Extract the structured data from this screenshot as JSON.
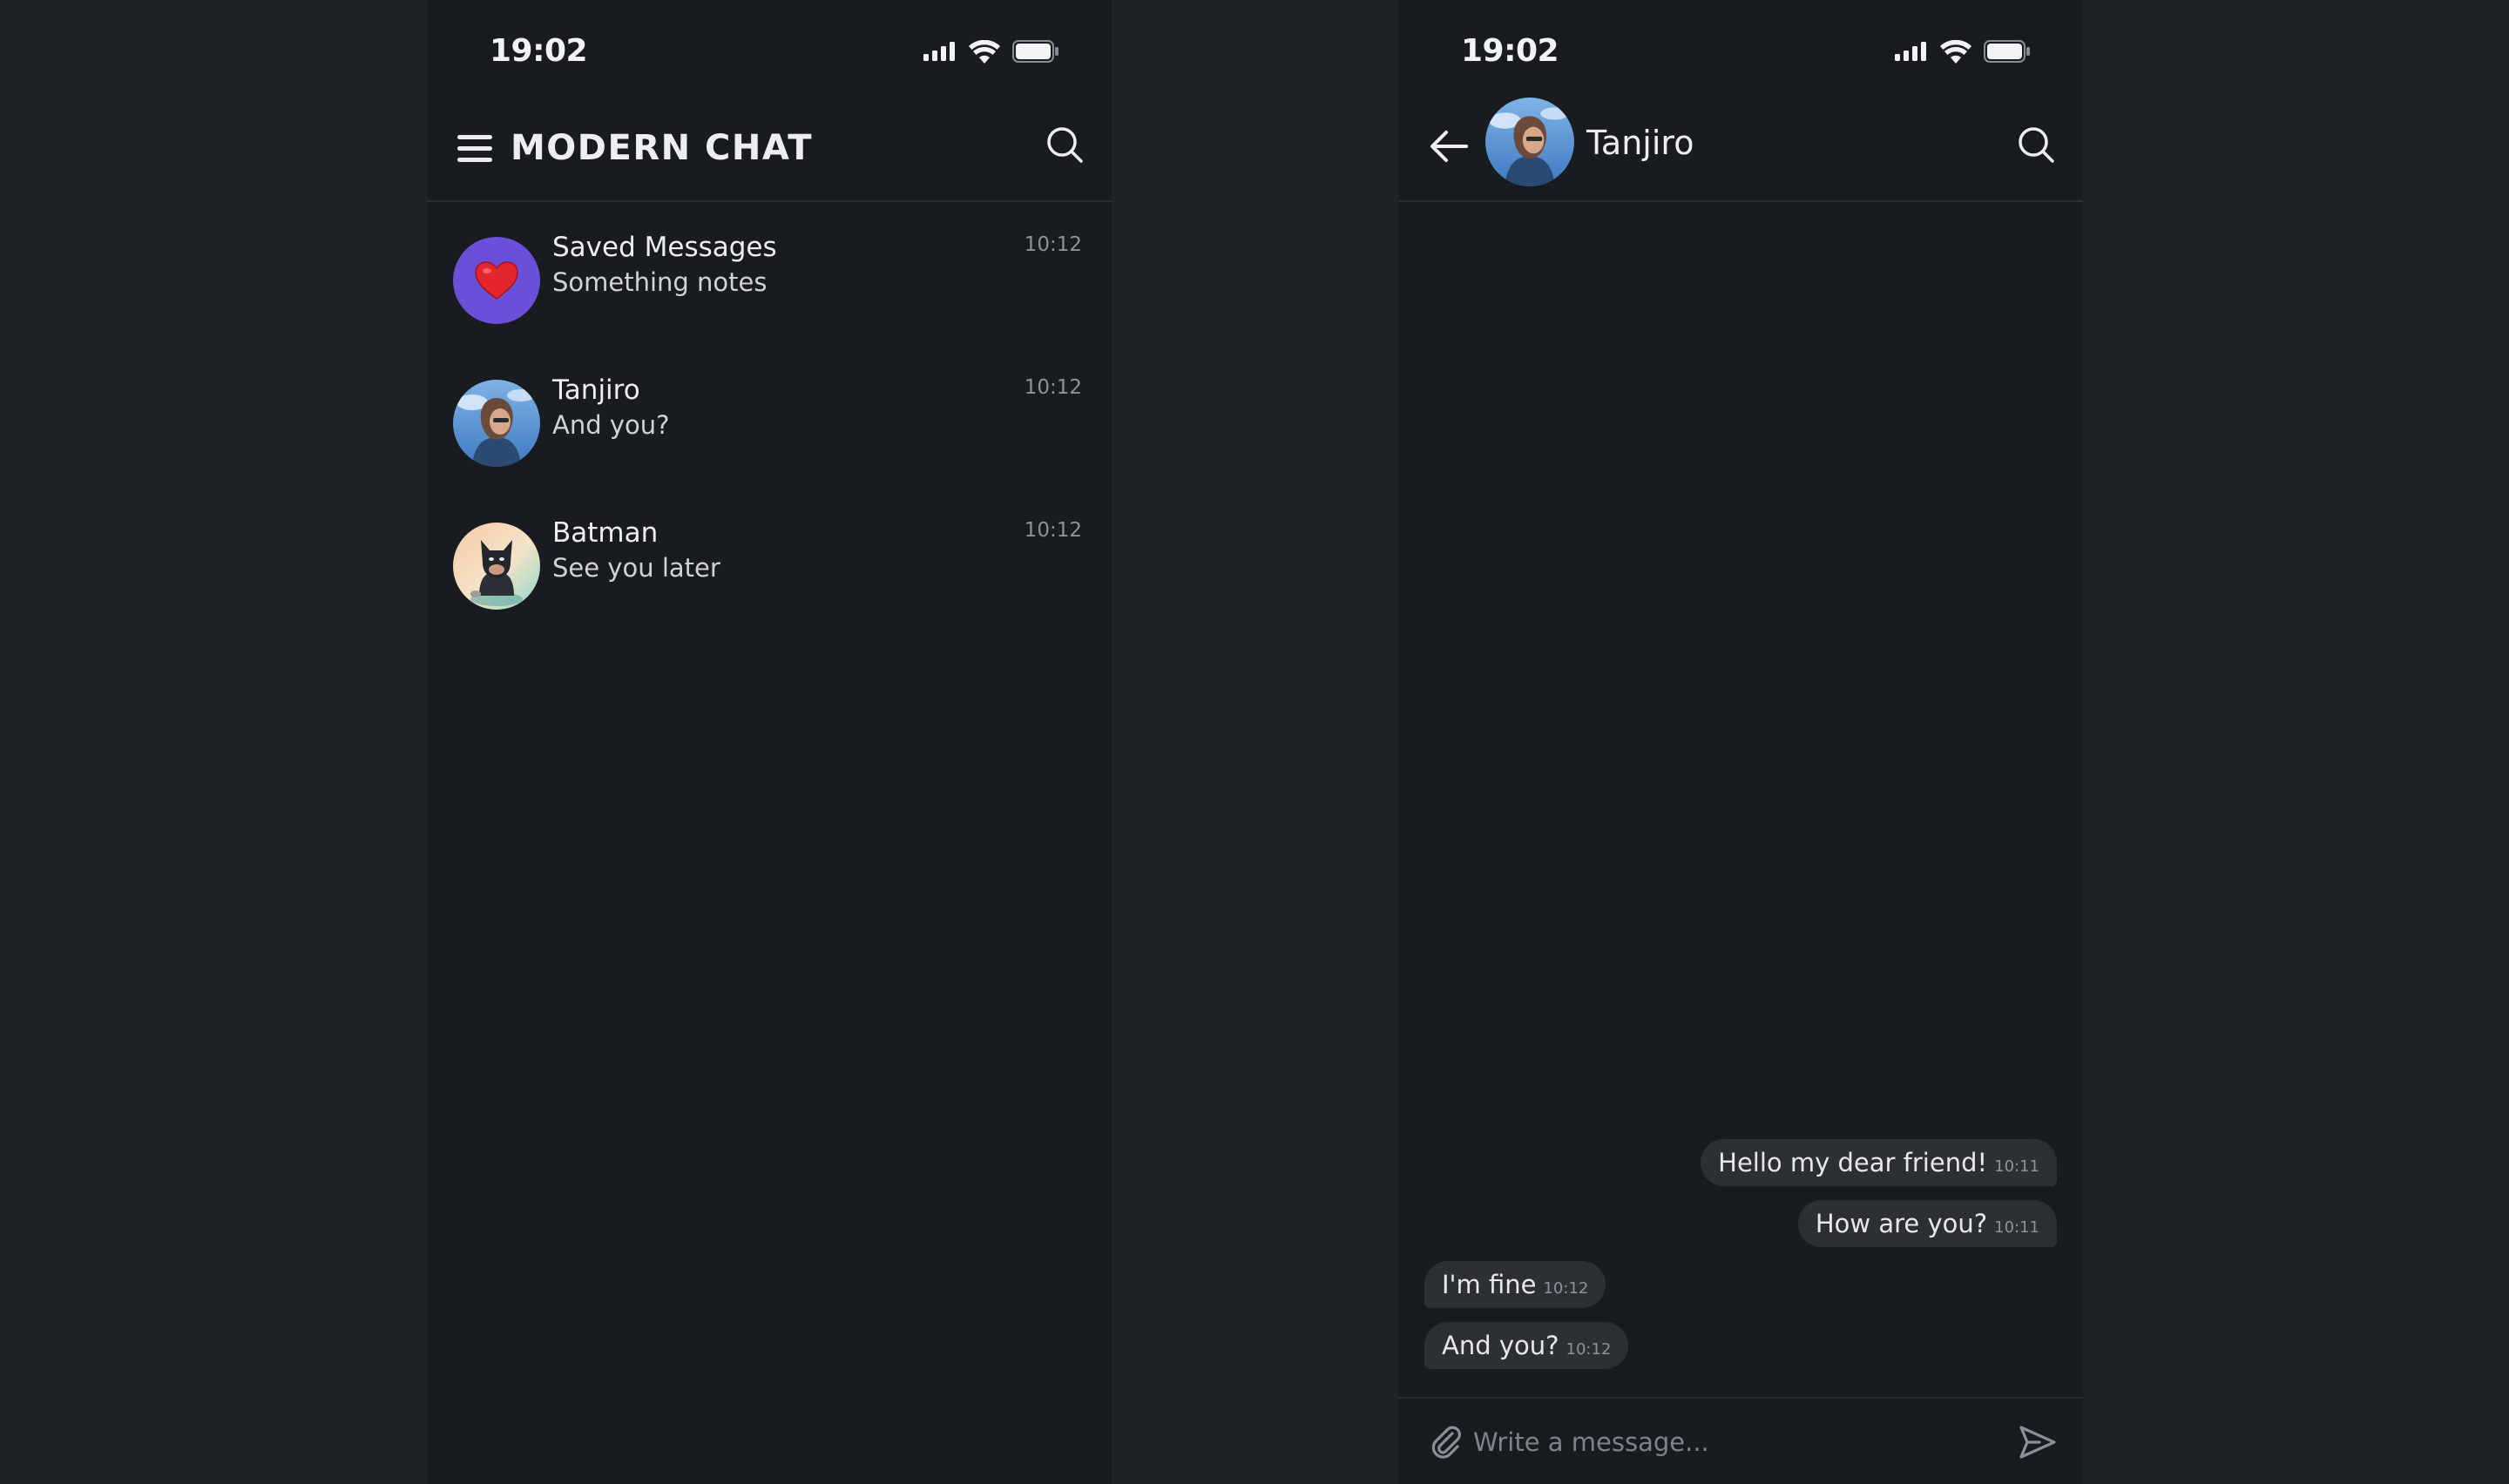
{
  "colors": {
    "page_background": "#1f2227",
    "phone_background": "#181b1f",
    "bubble": "#2c3035",
    "saved_avatar": "#6a4fd9",
    "divider": "#2a2e34"
  },
  "left_screen": {
    "status_time": "19:02",
    "status_icons": [
      "signal-icon",
      "wifi-icon",
      "battery-icon"
    ],
    "header": {
      "menu_icon": "hamburger-icon",
      "title": "MODERN CHAT",
      "search_icon": "search-icon"
    },
    "chats": [
      {
        "name": "Saved Messages",
        "preview": "Something notes",
        "time": "10:12",
        "avatar": "heart-icon"
      },
      {
        "name": "Tanjiro",
        "preview": "And you?",
        "time": "10:12",
        "avatar": "tanjiro-avatar"
      },
      {
        "name": "Batman",
        "preview": "See you later",
        "time": "10:12",
        "avatar": "batman-avatar"
      }
    ]
  },
  "right_screen": {
    "status_time": "19:02",
    "status_icons": [
      "signal-icon",
      "wifi-icon",
      "battery-icon"
    ],
    "header": {
      "back_icon": "arrow-left-icon",
      "contact_name": "Tanjiro",
      "search_icon": "search-icon"
    },
    "messages": [
      {
        "direction": "out",
        "text": "Hello my dear friend!",
        "time": "10:11"
      },
      {
        "direction": "out",
        "text": "How are you?",
        "time": "10:11"
      },
      {
        "direction": "in",
        "text": "I'm fine",
        "time": "10:12"
      },
      {
        "direction": "in",
        "text": "And you?",
        "time": "10:12"
      }
    ],
    "composer": {
      "attach_icon": "paperclip-icon",
      "placeholder": "Write a message...",
      "value": "",
      "send_icon": "send-icon"
    }
  }
}
